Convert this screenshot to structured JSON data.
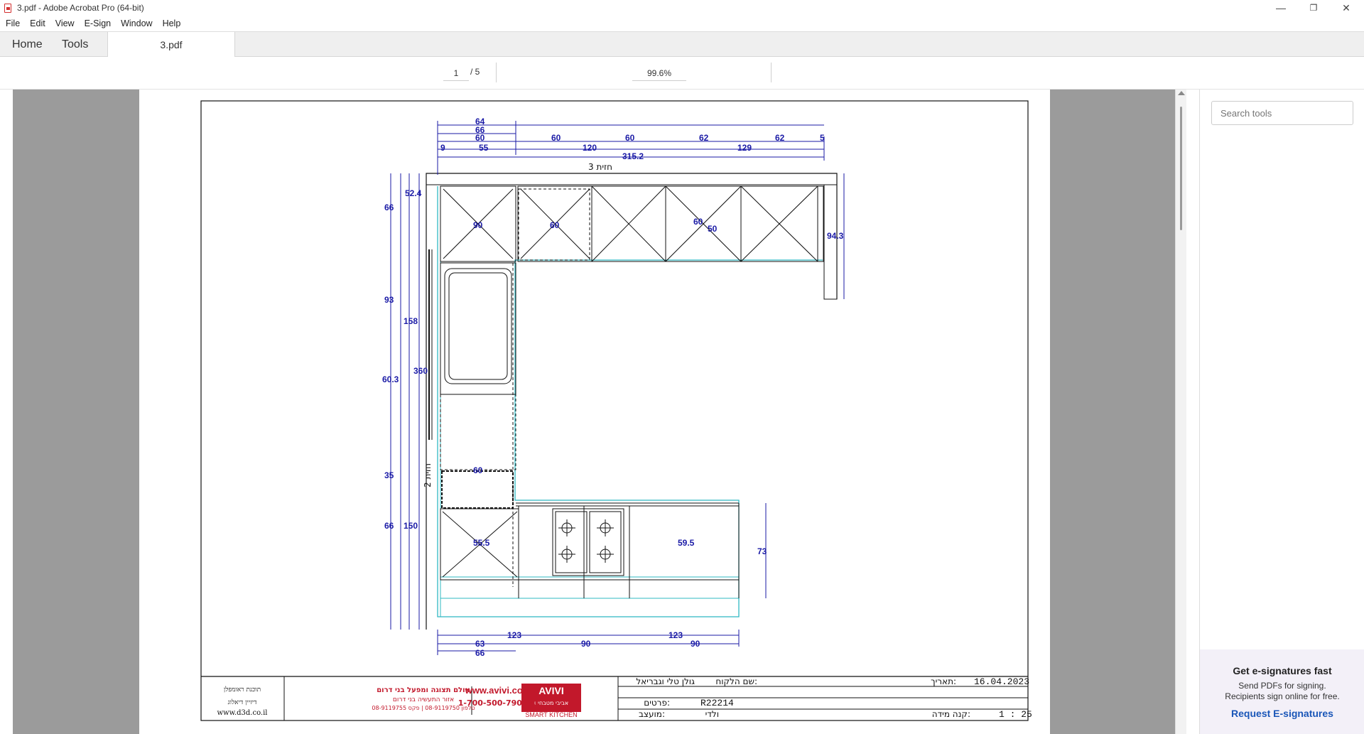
{
  "window": {
    "title": "3.pdf - Adobe Acrobat Pro (64-bit)",
    "controls": {
      "minimize": "—",
      "restore": "❐",
      "close": "✕"
    }
  },
  "menu": [
    "File",
    "Edit",
    "View",
    "E-Sign",
    "Window",
    "Help"
  ],
  "tabs": {
    "home": "Home",
    "tools": "Tools",
    "document": "3.pdf"
  },
  "nav": {
    "page_current": "1",
    "page_total": "/ 5",
    "zoom": "99.6%"
  },
  "right_panel": {
    "search_placeholder": "Search tools",
    "promo_title": "Get e-signatures fast",
    "promo_line1": "Send PDFs for signing.",
    "promo_line2": "Recipients sign online for free.",
    "promo_link": "Request E-signatures"
  },
  "drawing": {
    "front_top_label": "חזית 3",
    "front_side_label": "חזית 2",
    "dims_top_rows": {
      "row1": [
        "64"
      ],
      "row2": [
        "66"
      ],
      "row3": [
        "60",
        "60",
        "60",
        "62",
        "62",
        "5"
      ],
      "row4": [
        "9",
        "55",
        "120",
        "129"
      ],
      "row5": [
        "315.2"
      ]
    },
    "dims_left": [
      "66",
      "52.4",
      "93",
      "158",
      "360",
      "60.3",
      "35",
      "66",
      "150"
    ],
    "dims_right": [
      "94.3",
      "73"
    ],
    "dims_inner": [
      "90",
      "60",
      "60",
      "50",
      "60",
      "55.5",
      "59.5"
    ],
    "dims_bottom": [
      "123",
      "123",
      "63",
      "90",
      "90",
      "66"
    ]
  },
  "title_block": {
    "customer_label": "שם הלקוח:",
    "customer_value": "גולן טלי וגבריאל",
    "date_label": "תאריך:",
    "date_value": "16.04.2023",
    "items_label": "פרטים:",
    "items_value": "R22214",
    "advisor_label": "מועצב:",
    "advisor_value": "ולדי",
    "scale_label": "קנה מידה:",
    "scale_value": "1 : 25",
    "brand_name": "AVIVI",
    "brand_hebrew": "אביבי מטבחים",
    "brand_sub": "SMART KITCHEN",
    "website": "www.avivi.com",
    "phone": "טל: 1-700-500-790",
    "showroom_title": "אולם תצוגה ומפעל בני דרום",
    "showroom_addr": "אזור התעשיה בני דרום",
    "showroom_phones": "טלפון 08-9119750 | פקס 08-9119755",
    "software_line1": "תוכנת ראומפלן",
    "software_line2": "דיזיין דיאלוג",
    "software_url": "www.d3d.co.il"
  }
}
